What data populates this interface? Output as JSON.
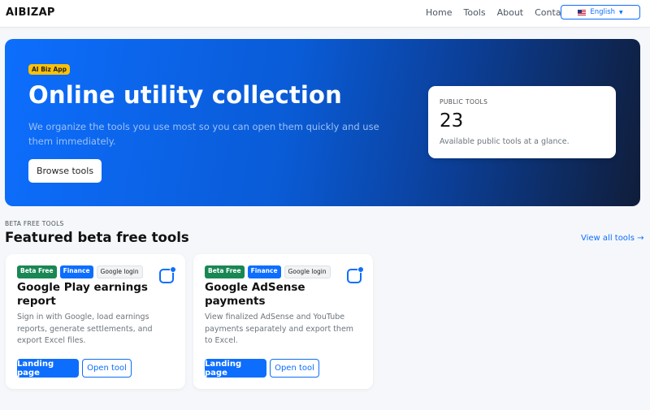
{
  "navbar": {
    "brand": "AIBIZAP",
    "links": [
      "Home",
      "Tools",
      "About",
      "Contact"
    ],
    "language": "English"
  },
  "hero": {
    "badge": "AI Biz App",
    "title": "Online utility collection",
    "subtitle": "We organize the tools you use most so you can open them quickly and use them immediately.",
    "cta": "Browse tools",
    "stat": {
      "label": "PUBLIC TOOLS",
      "value": "23",
      "description": "Available public tools at a glance."
    }
  },
  "section": {
    "eyebrow": "BETA FREE TOOLS",
    "title": "Featured beta free tools",
    "view_all": "View all tools →"
  },
  "cards": [
    {
      "tags": [
        "Beta Free",
        "Finance",
        "Google login"
      ],
      "title": "Google Play earnings report",
      "description": "Sign in with Google, load earnings reports, generate settlements, and export Excel files.",
      "primary": "Landing page",
      "secondary": "Open tool"
    },
    {
      "tags": [
        "Beta Free",
        "Finance",
        "Google login"
      ],
      "title": "Google AdSense payments",
      "description": "View finalized AdSense and YouTube payments separately and export them to Excel.",
      "primary": "Landing page",
      "secondary": "Open tool"
    }
  ],
  "colors": {
    "accent": "#0d6efd",
    "badge_yellow": "#ffc107",
    "tag_green": "#198754"
  },
  "icons": {
    "card_icon": "notification-app-icon",
    "flag": "us-flag-icon"
  }
}
